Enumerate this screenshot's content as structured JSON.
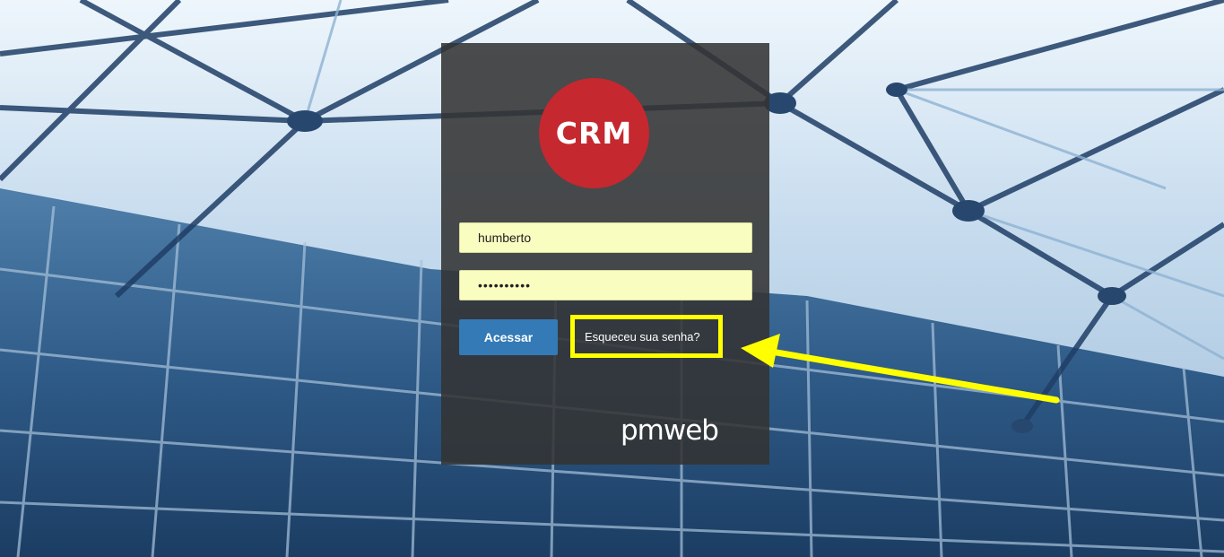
{
  "logo": {
    "crm_text": "CRM",
    "brand_text": "pmweb"
  },
  "login": {
    "username_value": "humberto",
    "password_value": "••••••••••",
    "submit_label": "Acessar",
    "forgot_password_label": "Esqueceu sua senha?"
  },
  "colors": {
    "crm_red": "#c5282f",
    "button_blue": "#337ab7",
    "field_yellow": "#fafdc0",
    "highlight_yellow": "#ffff00",
    "panel_dark": "#333333"
  },
  "icons": {
    "annotation": "arrow-left-icon"
  }
}
